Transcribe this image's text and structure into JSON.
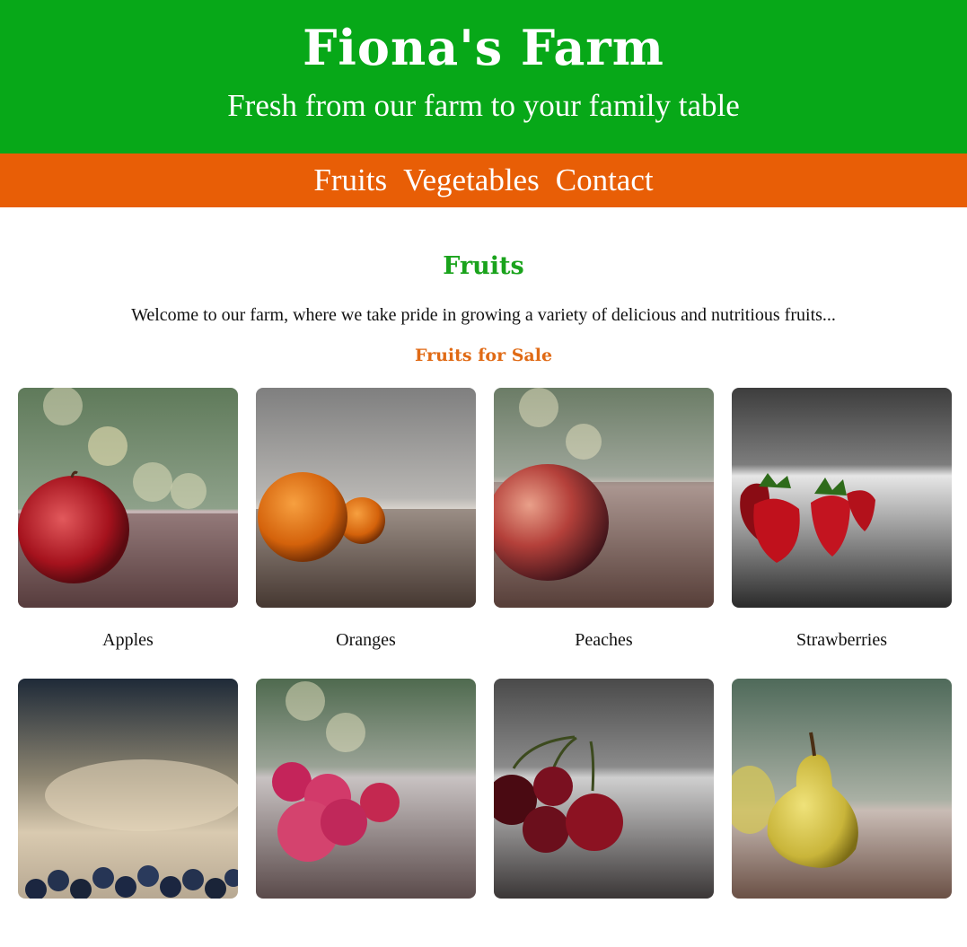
{
  "header": {
    "title": "Fiona's Farm",
    "tagline": "Fresh from our farm to your family table"
  },
  "nav": {
    "items": [
      "Fruits",
      "Vegetables",
      "Contact"
    ]
  },
  "main": {
    "section_title": "Fruits",
    "intro": "Welcome to our farm, where we take pride in growing a variety of delicious and nutritious fruits...",
    "subsection_title": "Fruits for Sale",
    "products": [
      "Apples",
      "Oranges",
      "Peaches",
      "Strawberries",
      "",
      "",
      "",
      ""
    ]
  },
  "colors": {
    "header_bg": "#07a818",
    "nav_bg": "#e85e06",
    "section_title": "#1aa31c",
    "subsection_title": "#e06a15"
  }
}
